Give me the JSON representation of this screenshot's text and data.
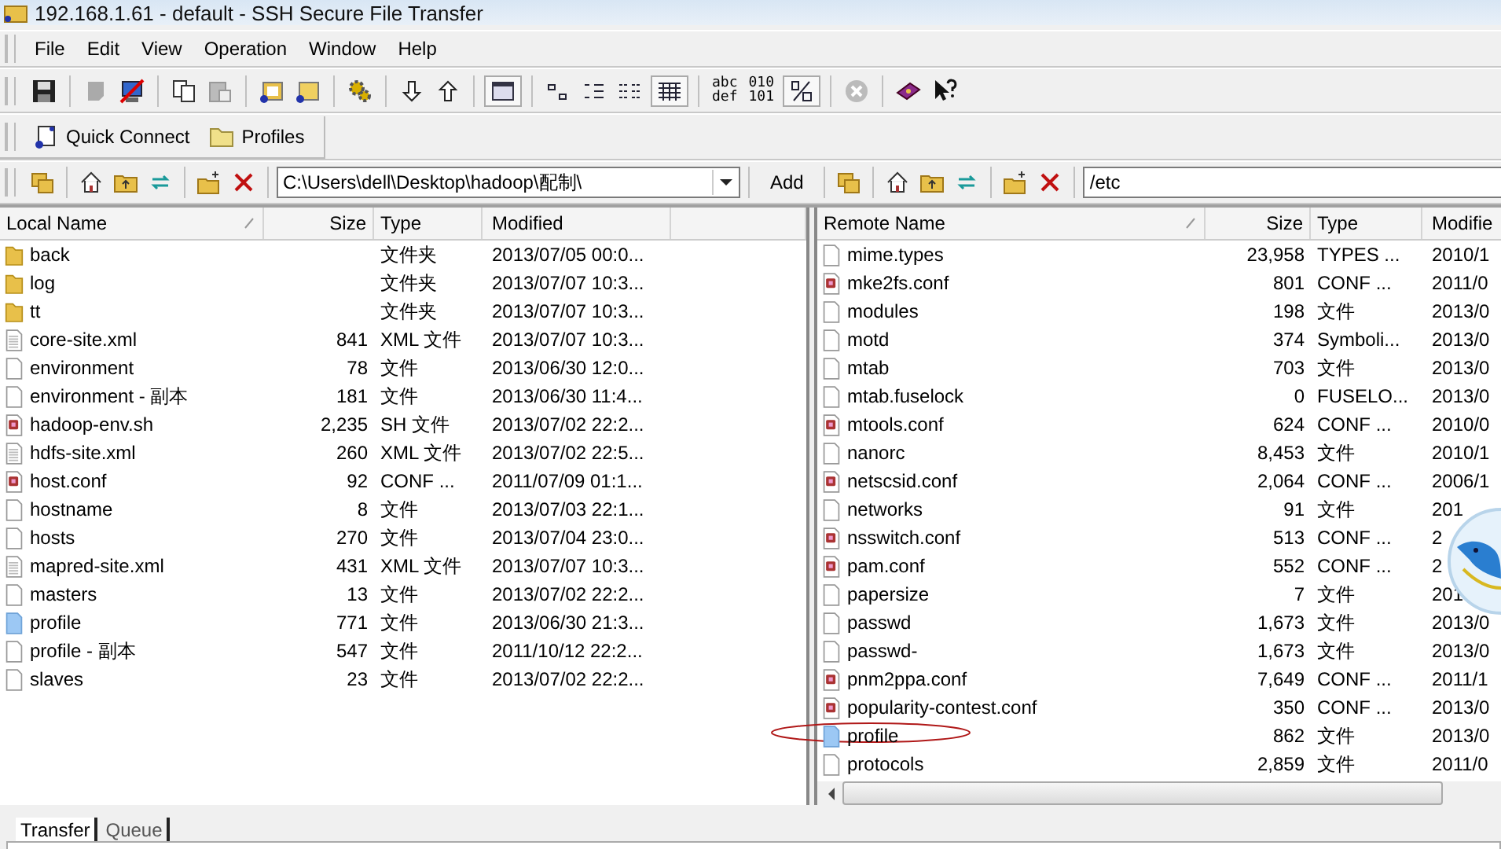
{
  "window": {
    "title": "192.168.1.61 - default - SSH Secure File Transfer"
  },
  "menu": [
    "File",
    "Edit",
    "View",
    "Operation",
    "Window",
    "Help"
  ],
  "toolbar_text_buttons": [
    {
      "lines": [
        "abc",
        "def"
      ]
    },
    {
      "lines": [
        "010",
        "101"
      ]
    }
  ],
  "quick_bar": [
    "Quick Connect",
    "Profiles"
  ],
  "local_path": {
    "value": "C:\\Users\\dell\\Desktop\\hadoop\\配制\\"
  },
  "add_button": "Add",
  "remote_path": {
    "value": "/etc"
  },
  "local": {
    "columns": [
      "Local Name",
      "Size",
      "Type",
      "Modified"
    ],
    "rows": [
      {
        "kind": "folder",
        "name": "back",
        "size": "",
        "type": "文件夹",
        "modified": "2013/07/05 00:0..."
      },
      {
        "kind": "folder",
        "name": "log",
        "size": "",
        "type": "文件夹",
        "modified": "2013/07/07 10:3..."
      },
      {
        "kind": "folder",
        "name": "tt",
        "size": "",
        "type": "文件夹",
        "modified": "2013/07/07 10:3..."
      },
      {
        "kind": "text",
        "name": "core-site.xml",
        "size": "841",
        "type": "XML 文件",
        "modified": "2013/07/07 10:3..."
      },
      {
        "kind": "file",
        "name": "environment",
        "size": "78",
        "type": "文件",
        "modified": "2013/06/30 12:0..."
      },
      {
        "kind": "file",
        "name": "environment - 副本",
        "size": "181",
        "type": "文件",
        "modified": "2013/06/30 11:4..."
      },
      {
        "kind": "conf",
        "name": "hadoop-env.sh",
        "size": "2,235",
        "type": "SH 文件",
        "modified": "2013/07/02 22:2..."
      },
      {
        "kind": "text",
        "name": "hdfs-site.xml",
        "size": "260",
        "type": "XML 文件",
        "modified": "2013/07/02 22:5..."
      },
      {
        "kind": "conf",
        "name": "host.conf",
        "size": "92",
        "type": "CONF ...",
        "modified": "2011/07/09 01:1..."
      },
      {
        "kind": "file",
        "name": "hostname",
        "size": "8",
        "type": "文件",
        "modified": "2013/07/03 22:1..."
      },
      {
        "kind": "file",
        "name": "hosts",
        "size": "270",
        "type": "文件",
        "modified": "2013/07/04 23:0..."
      },
      {
        "kind": "text",
        "name": "mapred-site.xml",
        "size": "431",
        "type": "XML 文件",
        "modified": "2013/07/07 10:3..."
      },
      {
        "kind": "file",
        "name": "masters",
        "size": "13",
        "type": "文件",
        "modified": "2013/07/02 22:2..."
      },
      {
        "kind": "blue",
        "name": "profile",
        "size": "771",
        "type": "文件",
        "modified": "2013/06/30 21:3..."
      },
      {
        "kind": "file",
        "name": "profile - 副本",
        "size": "547",
        "type": "文件",
        "modified": "2011/10/12 22:2..."
      },
      {
        "kind": "file",
        "name": "slaves",
        "size": "23",
        "type": "文件",
        "modified": "2013/07/02 22:2..."
      }
    ]
  },
  "remote": {
    "columns": [
      "Remote Name",
      "Size",
      "Type",
      "Modifie"
    ],
    "rows": [
      {
        "kind": "file",
        "name": "mime.types",
        "size": "23,958",
        "type": "TYPES ...",
        "modified": "2010/1"
      },
      {
        "kind": "conf",
        "name": "mke2fs.conf",
        "size": "801",
        "type": "CONF ...",
        "modified": "2011/0"
      },
      {
        "kind": "file",
        "name": "modules",
        "size": "198",
        "type": "文件",
        "modified": "2013/0"
      },
      {
        "kind": "file",
        "name": "motd",
        "size": "374",
        "type": "Symboli...",
        "modified": "2013/0"
      },
      {
        "kind": "file",
        "name": "mtab",
        "size": "703",
        "type": "文件",
        "modified": "2013/0"
      },
      {
        "kind": "file",
        "name": "mtab.fuselock",
        "size": "0",
        "type": "FUSELO...",
        "modified": "2013/0"
      },
      {
        "kind": "conf",
        "name": "mtools.conf",
        "size": "624",
        "type": "CONF ...",
        "modified": "2010/0"
      },
      {
        "kind": "file",
        "name": "nanorc",
        "size": "8,453",
        "type": "文件",
        "modified": "2010/1"
      },
      {
        "kind": "conf",
        "name": "netscsid.conf",
        "size": "2,064",
        "type": "CONF ...",
        "modified": "2006/1"
      },
      {
        "kind": "file",
        "name": "networks",
        "size": "91",
        "type": "文件",
        "modified": "201"
      },
      {
        "kind": "conf",
        "name": "nsswitch.conf",
        "size": "513",
        "type": "CONF ...",
        "modified": "2"
      },
      {
        "kind": "conf",
        "name": "pam.conf",
        "size": "552",
        "type": "CONF ...",
        "modified": "2"
      },
      {
        "kind": "file",
        "name": "papersize",
        "size": "7",
        "type": "文件",
        "modified": "201"
      },
      {
        "kind": "file",
        "name": "passwd",
        "size": "1,673",
        "type": "文件",
        "modified": "2013/0"
      },
      {
        "kind": "file",
        "name": "passwd-",
        "size": "1,673",
        "type": "文件",
        "modified": "2013/0"
      },
      {
        "kind": "conf",
        "name": "pnm2ppa.conf",
        "size": "7,649",
        "type": "CONF ...",
        "modified": "2011/1"
      },
      {
        "kind": "conf",
        "name": "popularity-contest.conf",
        "size": "350",
        "type": "CONF ...",
        "modified": "2013/0"
      },
      {
        "kind": "blue",
        "name": "profile",
        "size": "862",
        "type": "文件",
        "modified": "2013/0"
      },
      {
        "kind": "file",
        "name": "protocols",
        "size": "2,859",
        "type": "文件",
        "modified": "2011/0"
      }
    ]
  },
  "bottom_tabs": [
    {
      "label": "Transfer",
      "selected": true
    },
    {
      "label": "Queue",
      "selected": false
    }
  ]
}
